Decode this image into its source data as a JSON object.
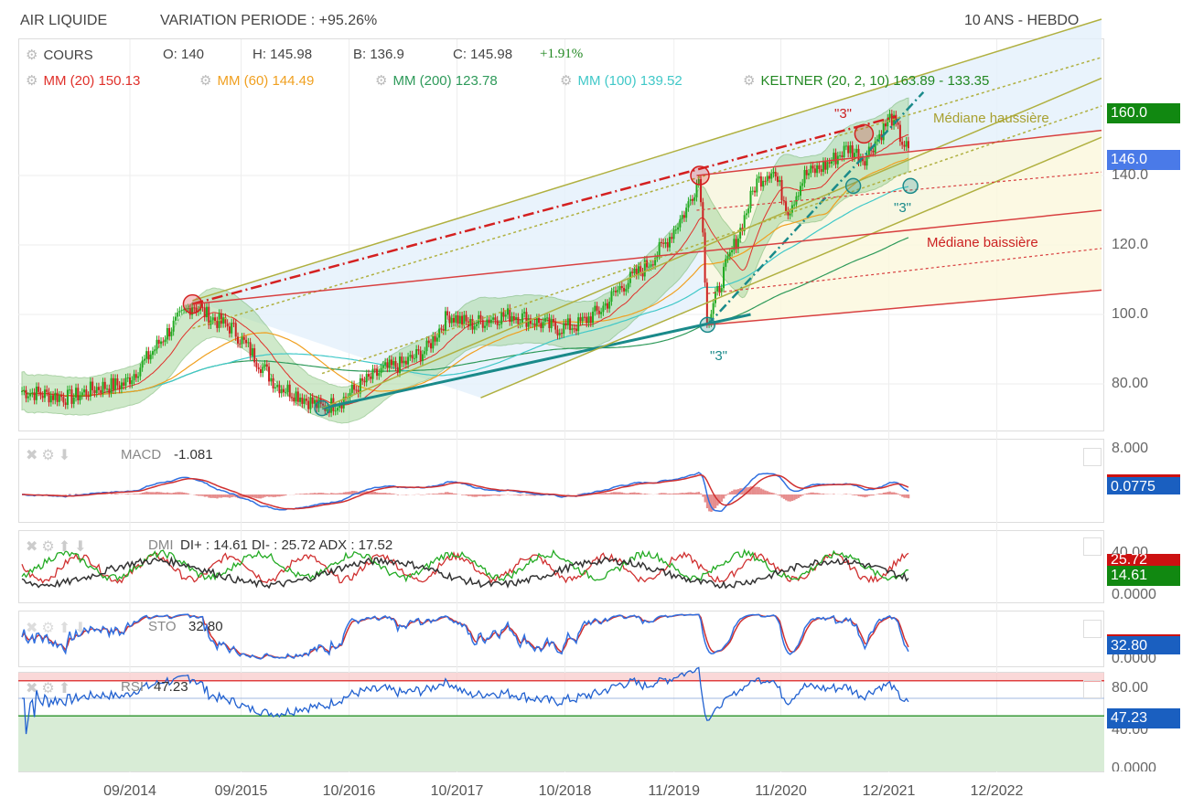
{
  "header": {
    "title": "AIR LIQUIDE",
    "variation": "VARIATION PERIODE : +95.26%",
    "period": "10 ANS - HEBDO"
  },
  "legend": {
    "cours": "COURS",
    "o": "O: 140",
    "h": "H: 145.98",
    "b": "B: 136.9",
    "c": "C: 145.98",
    "chg": "+1.91%",
    "mm20": "MM (20)  150.13",
    "mm60": "MM (60)  144.49",
    "mm200": "MM (200)  123.78",
    "mm100": "MM (100)  139.52",
    "keltner": "KELTNER (20, 2, 10)  163.89 - 133.35"
  },
  "colors": {
    "up": "#22aa22",
    "down": "#cc2222",
    "mm20": "#e0302a",
    "mm60": "#f0a020",
    "mm200": "#2e9a5a",
    "mm100": "#40c8c8",
    "blue": "#1a5fc0"
  },
  "annotations": {
    "mediane_haussiere": "Médiane haussière",
    "mediane_baissiere": "Médiane baissière",
    "three": "\"3\""
  },
  "price_tags": {
    "top": "160.0",
    "last": "146.0"
  },
  "indicators": {
    "macd": {
      "label": "MACD",
      "value": "-1.081",
      "axis_top": "8.000",
      "tag": "0.0775"
    },
    "dmi": {
      "label": "DMI",
      "value": "DI+ : 14.61 DI- : 25.72 ADX : 17.52",
      "axis_top": "40.00",
      "axis_bottom": "0.0000",
      "tag_red": "25.72",
      "tag_green": "14.61"
    },
    "sto": {
      "label": "STO",
      "value": "32.80",
      "axis_bottom": "0.0000",
      "tag": "32.80"
    },
    "rsi": {
      "label": "RSI",
      "value": "47.23",
      "axis_top": "80.00",
      "axis_mid": "40.00",
      "axis_bottom": "0.0000",
      "tag": "47.23"
    }
  },
  "chart_data": {
    "type": "line",
    "title": "AIR LIQUIDE - 10 ANS - HEBDO",
    "x_ticks": [
      {
        "t": 2014.75,
        "label": "09/2014"
      },
      {
        "t": 2015.78,
        "label": "09/2015"
      },
      {
        "t": 2016.78,
        "label": "10/2016"
      },
      {
        "t": 2017.78,
        "label": "10/2017"
      },
      {
        "t": 2018.78,
        "label": "10/2018"
      },
      {
        "t": 2019.79,
        "label": "11/2019"
      },
      {
        "t": 2020.78,
        "label": "11/2020"
      },
      {
        "t": 2021.78,
        "label": "12/2021"
      },
      {
        "t": 2022.78,
        "label": "12/2022"
      }
    ],
    "y_ticks": [
      {
        "v": 140,
        "label": "140.0"
      },
      {
        "v": 120,
        "label": "120.0"
      },
      {
        "v": 100,
        "label": "100.0"
      },
      {
        "v": 80,
        "label": "80.00"
      }
    ],
    "xlim": [
      2013.75,
      2023.75
    ],
    "ylim": [
      69,
      181
    ],
    "price": [
      [
        2013.75,
        78
      ],
      [
        2013.95,
        77
      ],
      [
        2014.2,
        76
      ],
      [
        2014.45,
        79
      ],
      [
        2014.7,
        80
      ],
      [
        2014.9,
        87
      ],
      [
        2015.1,
        95
      ],
      [
        2015.33,
        103
      ],
      [
        2015.5,
        99
      ],
      [
        2015.7,
        96
      ],
      [
        2015.9,
        88
      ],
      [
        2016.1,
        80
      ],
      [
        2016.3,
        77
      ],
      [
        2016.53,
        73
      ],
      [
        2016.7,
        75
      ],
      [
        2016.9,
        80
      ],
      [
        2017.1,
        84
      ],
      [
        2017.3,
        86
      ],
      [
        2017.5,
        90
      ],
      [
        2017.7,
        100
      ],
      [
        2017.9,
        97
      ],
      [
        2018.1,
        99
      ],
      [
        2018.3,
        100
      ],
      [
        2018.5,
        98
      ],
      [
        2018.7,
        96
      ],
      [
        2018.9,
        97
      ],
      [
        2019.1,
        101
      ],
      [
        2019.3,
        108
      ],
      [
        2019.5,
        113
      ],
      [
        2019.7,
        120
      ],
      [
        2019.9,
        130
      ],
      [
        2020.03,
        140
      ],
      [
        2020.1,
        97
      ],
      [
        2020.25,
        112
      ],
      [
        2020.4,
        124
      ],
      [
        2020.55,
        138
      ],
      [
        2020.7,
        142
      ],
      [
        2020.85,
        130
      ],
      [
        2021.0,
        140
      ],
      [
        2021.2,
        143
      ],
      [
        2021.4,
        148
      ],
      [
        2021.55,
        145
      ],
      [
        2021.7,
        152
      ],
      [
        2021.8,
        157
      ],
      [
        2021.9,
        150
      ],
      [
        2021.98,
        146
      ]
    ],
    "trendlines": [
      {
        "color": "#d42020",
        "dash": "12,4,2,4",
        "w": 2.5,
        "p": [
          [
            2015.33,
            103
          ],
          [
            2021.85,
            157
          ]
        ]
      },
      {
        "color": "#1a8a8a",
        "dash": "",
        "w": 3,
        "p": [
          [
            2016.53,
            73
          ],
          [
            2020.5,
            100
          ]
        ]
      },
      {
        "color": "#1a8a8a",
        "dash": "10,4,2,4",
        "w": 2.5,
        "p": [
          [
            2020.1,
            97
          ],
          [
            2022.1,
            164
          ]
        ]
      },
      {
        "color": "#b0b040",
        "dash": "",
        "w": 1.5,
        "p": [
          [
            2015.33,
            104
          ],
          [
            2023.75,
            185
          ]
        ]
      },
      {
        "color": "#b0b040",
        "dash": "",
        "w": 1.5,
        "p": [
          [
            2016.53,
            73
          ],
          [
            2023.75,
            168
          ]
        ]
      },
      {
        "color": "#b0b040",
        "dash": "",
        "w": 1.5,
        "p": [
          [
            2018.0,
            76
          ],
          [
            2023.75,
            151
          ]
        ]
      },
      {
        "color": "#b0b040",
        "dash": "3,3",
        "w": 1.5,
        "p": [
          [
            2015.33,
            96
          ],
          [
            2023.75,
            174
          ]
        ]
      },
      {
        "color": "#b0b040",
        "dash": "3,3",
        "w": 1.5,
        "p": [
          [
            2016.53,
            83
          ],
          [
            2023.75,
            160
          ]
        ]
      },
      {
        "color": "#d84040",
        "dash": "",
        "w": 1.5,
        "p": [
          [
            2015.33,
            103
          ],
          [
            2023.75,
            130
          ]
        ]
      },
      {
        "color": "#d84040",
        "dash": "",
        "w": 1.5,
        "p": [
          [
            2020.1,
            97
          ],
          [
            2023.75,
            107
          ]
        ]
      },
      {
        "color": "#d84040",
        "dash": "",
        "w": 1.5,
        "p": [
          [
            2020.0,
            140
          ],
          [
            2023.75,
            153
          ]
        ]
      },
      {
        "color": "#d84040",
        "dash": "3,3",
        "w": 1.2,
        "p": [
          [
            2020.0,
            130
          ],
          [
            2023.75,
            141
          ]
        ]
      },
      {
        "color": "#d84040",
        "dash": "3,3",
        "w": 1.2,
        "p": [
          [
            2020.1,
            106
          ],
          [
            2023.75,
            119
          ]
        ]
      }
    ],
    "circles": [
      [
        2015.33,
        103,
        "#d42020"
      ],
      [
        2020.03,
        140,
        "#d42020"
      ],
      [
        2021.55,
        152,
        "#d42020"
      ],
      [
        2016.53,
        73,
        "#1a8a8a"
      ],
      [
        2020.1,
        97,
        "#1a8a8a"
      ],
      [
        2021.98,
        137,
        "#1a8a8a"
      ],
      [
        2021.45,
        137,
        "#1a8a8a"
      ]
    ]
  }
}
